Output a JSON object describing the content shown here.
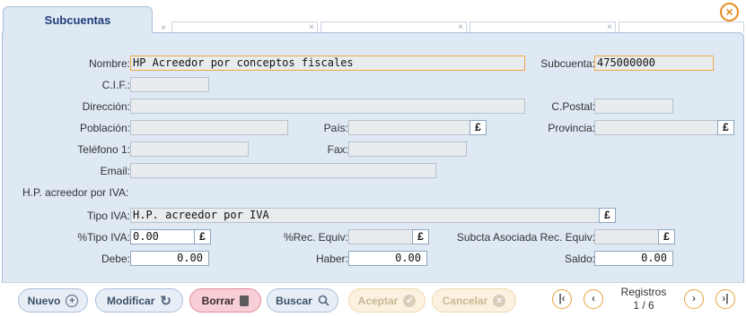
{
  "tabs": {
    "active_label": "Subcuentas",
    "close_glyph": "×"
  },
  "form": {
    "nombre_label": "Nombre:",
    "nombre_value": "HP Acreedor por conceptos fiscales",
    "subcuenta_label": "Subcuenta:",
    "subcuenta_value": "475000000",
    "cif_label": "C.I.F.:",
    "cif_value": "",
    "direccion_label": "Dirección:",
    "direccion_value": "",
    "cpostal_label": "C.Postal:",
    "cpostal_value": "",
    "poblacion_label": "Población:",
    "poblacion_value": "",
    "pais_label": "País:",
    "pais_value": "",
    "provincia_label": "Provincia:",
    "provincia_value": "",
    "telefono_label": "Teléfono 1:",
    "telefono_value": "",
    "fax_label": "Fax:",
    "fax_value": "",
    "email_label": "Email:",
    "email_value": "",
    "hp_section_label": "H.P. acreedor por IVA:",
    "tipo_iva_label": "Tipo IVA:",
    "tipo_iva_value": "H.P. acreedor por IVA",
    "pct_tipo_iva_label": "%Tipo IVA:",
    "pct_tipo_iva_value": "0.00",
    "rec_equiv_label": "%Rec. Equiv:",
    "rec_equiv_value": "",
    "subcta_rec_label": "Subcta Asociada Rec. Equiv:",
    "subcta_rec_value": "",
    "debe_label": "Debe:",
    "debe_value": "0.00",
    "haber_label": "Haber:",
    "haber_value": "0.00",
    "saldo_label": "Saldo:",
    "saldo_value": "0.00",
    "lookup_glyph": "£"
  },
  "toolbar": {
    "nuevo_label": "Nuevo",
    "modificar_label": "Modificar",
    "borrar_label": "Borrar",
    "buscar_label": "Buscar",
    "aceptar_label": "Aceptar",
    "cancelar_label": "Cancelar",
    "registros_label": "Registros",
    "registros_value": "1 / 6"
  },
  "colors": {
    "panel_bg": "#dfe9f4",
    "highlight_border": "#f0a848",
    "delete_bg": "#f8cfd6",
    "accent_orange": "#e7891f"
  }
}
